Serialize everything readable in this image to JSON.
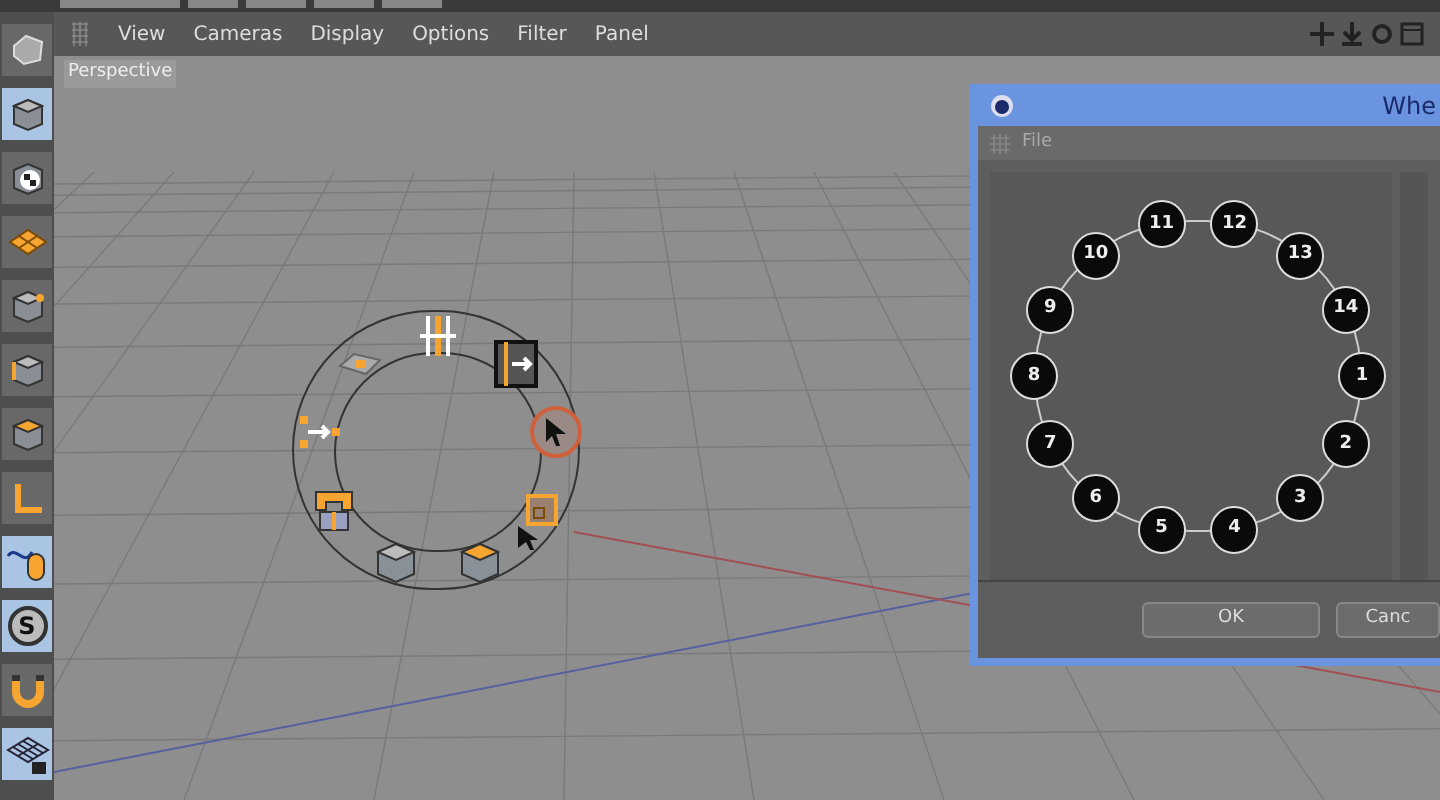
{
  "menu": [
    "View",
    "Cameras",
    "Display",
    "Options",
    "Filter",
    "Panel"
  ],
  "viewport": {
    "label": "Perspective"
  },
  "left_toolbar": [
    {
      "kind": "sculpt",
      "selected": false
    },
    {
      "kind": "cube",
      "selected": true
    },
    {
      "kind": "checker-cube",
      "selected": false
    },
    {
      "kind": "polygon-grid",
      "selected": false
    },
    {
      "kind": "point-cube",
      "selected": false
    },
    {
      "kind": "edge-cube",
      "selected": false
    },
    {
      "kind": "face-cube",
      "selected": false
    },
    {
      "kind": "axis",
      "selected": false
    },
    {
      "kind": "mouse",
      "selected": true
    },
    {
      "kind": "letter",
      "label": "S",
      "selected": true
    },
    {
      "kind": "magnet",
      "selected": false
    },
    {
      "kind": "lock-grid",
      "selected": true
    }
  ],
  "pie_menu": [
    {
      "kind": "sliders",
      "selected": false
    },
    {
      "kind": "panel-arrow",
      "selected": false
    },
    {
      "kind": "cursor",
      "selected": true
    },
    {
      "kind": "square",
      "selected": false
    },
    {
      "kind": "cube-top",
      "selected": false
    },
    {
      "kind": "cube",
      "selected": false
    },
    {
      "kind": "frame",
      "selected": false
    },
    {
      "kind": "arrow-dots",
      "selected": false
    },
    {
      "kind": "plane",
      "selected": false
    }
  ],
  "dialog": {
    "title": "Whe",
    "menu": [
      "File"
    ],
    "nodes": [
      "1",
      "2",
      "3",
      "4",
      "5",
      "6",
      "7",
      "8",
      "9",
      "10",
      "11",
      "12",
      "13",
      "14"
    ],
    "buttons": [
      "OK",
      "Canc"
    ]
  }
}
